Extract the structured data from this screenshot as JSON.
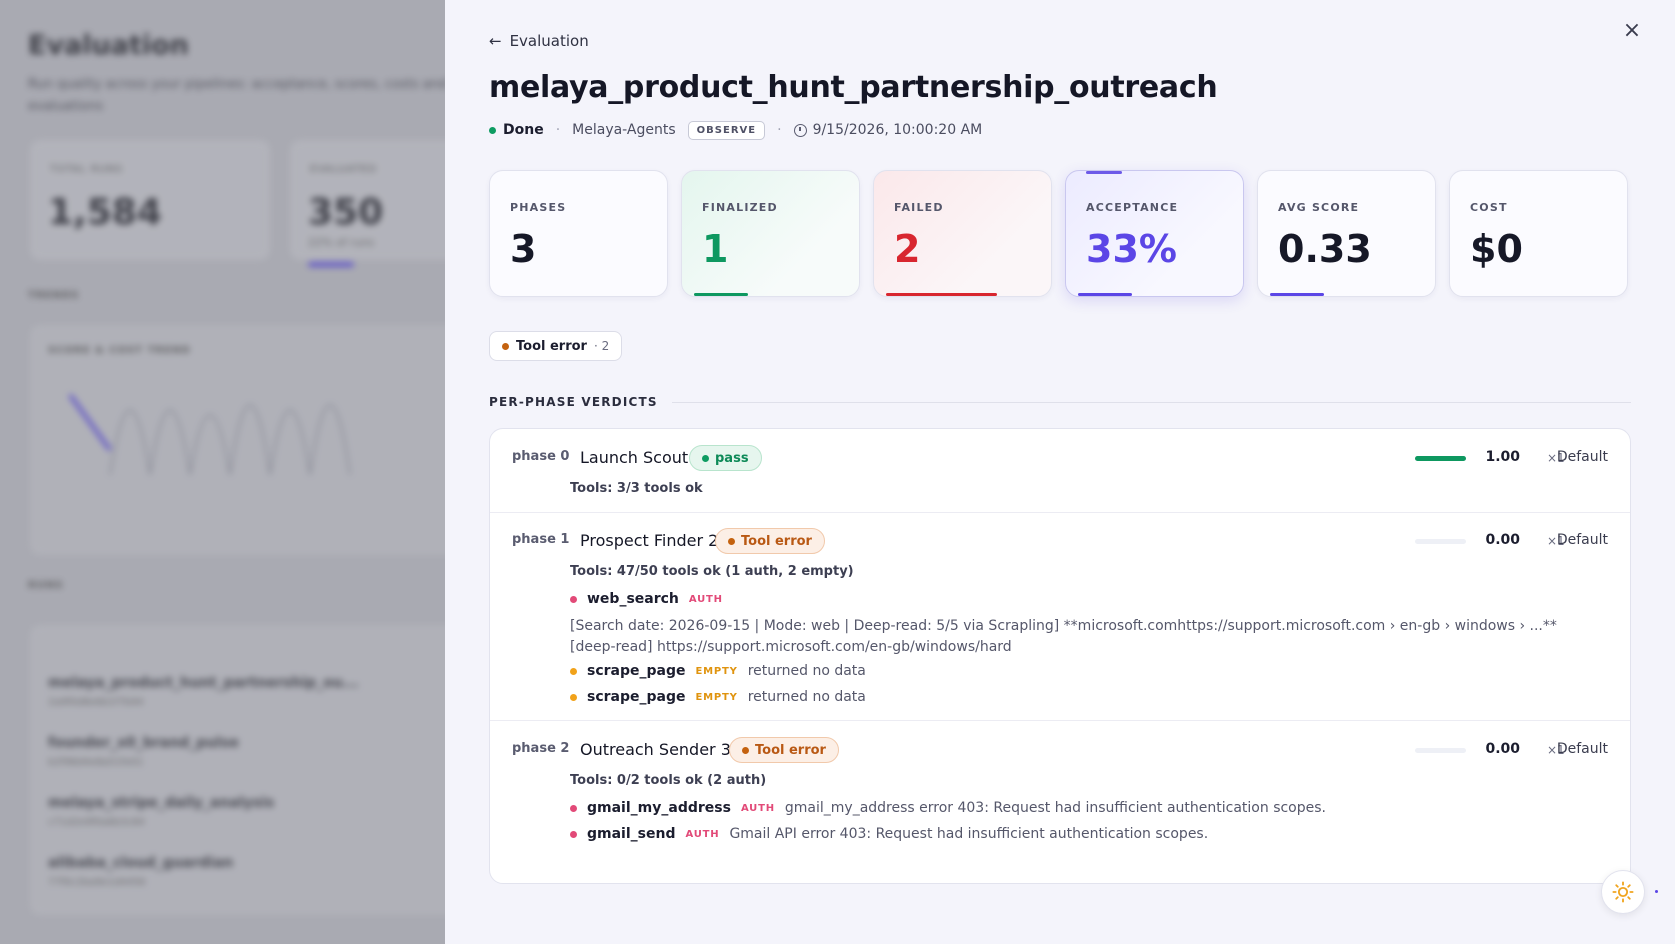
{
  "background": {
    "title": "Evaluation",
    "subtitle": "Run quality across your pipelines: acceptance, scores, costs and evaluations",
    "cards": [
      {
        "label": "TOTAL RUNS",
        "value": "1,584",
        "note": ""
      },
      {
        "label": "EVALUATED",
        "value": "350",
        "note": "22% of runs"
      }
    ],
    "trends_label": "TRENDS",
    "chart_label": "SCORE & COST TREND",
    "runs_label": "RUNS",
    "runs": [
      {
        "name": "melaya_product_hunt_partnership_ou...",
        "id": "2a9f0d8e6b1f7b94"
      },
      {
        "name": "founder_x0_brand_pulse",
        "id": "b2f98d4e8a51fe01"
      },
      {
        "name": "melaya_stripe_daily_analysis",
        "id": "c71d2e9f0a6b3c84"
      },
      {
        "name": "alibaba_cloud_guardian",
        "id": "77f0c2ba9e1d4456"
      }
    ]
  },
  "drawer": {
    "back_label": "Evaluation",
    "title": "melaya_product_hunt_partnership_outreach",
    "status": "Done",
    "project": "Melaya-Agents",
    "mode_badge": "OBSERVE",
    "timestamp": "9/15/2026, 10:00:20 AM",
    "close_icon": "close-icon",
    "stats": [
      {
        "label": "PHASES",
        "value": "3",
        "bar": 0,
        "color": "#161827"
      },
      {
        "label": "FINALIZED",
        "value": "1",
        "bar": 0.33,
        "color": "#0e9860"
      },
      {
        "label": "FAILED",
        "value": "2",
        "bar": 0.67,
        "color": "#d8262f"
      },
      {
        "label": "ACCEPTANCE",
        "value": "33%",
        "bar": 0.33,
        "color": "#5b46e6"
      },
      {
        "label": "AVG SCORE",
        "value": "0.33",
        "bar": 0.33,
        "color": "#5b46e6"
      },
      {
        "label": "COST",
        "value": "$0",
        "bar": 0,
        "color": "#161827"
      }
    ],
    "error_chip": {
      "label": "Tool error",
      "count": "· 2"
    },
    "section_title": "PER-PHASE VERDICTS",
    "phases": [
      {
        "id": "phase 0",
        "name": "Launch Scout",
        "verdict": "pass",
        "score": 1.0,
        "score_label": "1.00",
        "multiplier": "×1",
        "profile": "Default",
        "tools_summary": "Tools: 3/3 tools ok",
        "tools": []
      },
      {
        "id": "phase 1",
        "name": "Prospect Finder 2",
        "verdict": "Tool error",
        "score": 0.0,
        "score_label": "0.00",
        "multiplier": "×1",
        "profile": "Default",
        "tools_summary": "Tools: 47/50 tools ok (1 auth, 2 empty)",
        "tools": [
          {
            "name": "web_search",
            "tag": "AUTH",
            "message": ""
          },
          {
            "name": "scrape_page",
            "tag": "EMPTY",
            "message": "returned no data"
          },
          {
            "name": "scrape_page",
            "tag": "EMPTY",
            "message": "returned no data"
          }
        ],
        "raw_output": "[Search date: 2026-09-15 | Mode: web | Deep-read: 5/5 via Scrapling] **microsoft.comhttps://support.microsoft.com › en-gb › windows › ...** [deep-read] https://support.microsoft.com/en-gb/windows/hard"
      },
      {
        "id": "phase 2",
        "name": "Outreach Sender 3",
        "verdict": "Tool error",
        "score": 0.0,
        "score_label": "0.00",
        "multiplier": "×1",
        "profile": "Default",
        "tools_summary": "Tools: 0/2 tools ok (2 auth)",
        "tools": [
          {
            "name": "gmail_my_address",
            "tag": "AUTH",
            "message": "gmail_my_address error 403: Request had insufficient authentication scopes."
          },
          {
            "name": "gmail_send",
            "tag": "AUTH",
            "message": "Gmail API error 403: Request had insufficient authentication scopes."
          }
        ]
      }
    ],
    "theme_icon": "sun-icon"
  }
}
